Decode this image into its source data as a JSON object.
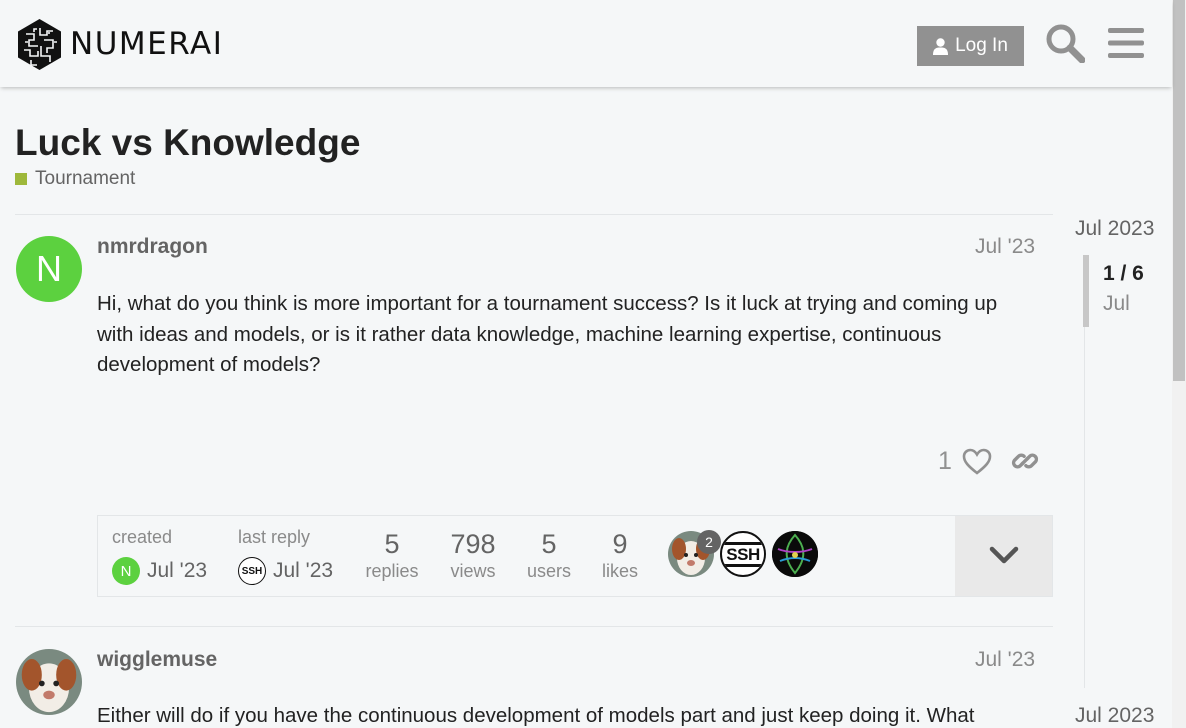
{
  "header": {
    "brand": "NUMERAI",
    "login_label": "Log In"
  },
  "topic": {
    "title": "Luck vs Knowledge",
    "category": "Tournament",
    "category_color": "#9eb83b"
  },
  "posts": [
    {
      "username": "nmrdragon",
      "avatar_letter": "N",
      "avatar_color": "#5cd13f",
      "date": "Jul '23",
      "body": "Hi, what do you think is more important for a tournament success? Is it luck at trying and coming up with ideas and models, or is it rather data knowledge, machine learning expertise, continuous development of models?",
      "likes": "1"
    },
    {
      "username": "wigglemuse",
      "date": "Jul '23",
      "body": "Either will do if you have the continuous development of models part and just keep doing it. What"
    }
  ],
  "summary": {
    "created_label": "created",
    "created_date": "Jul '23",
    "created_avatar": "N",
    "last_reply_label": "last reply",
    "last_reply_date": "Jul '23",
    "last_reply_avatar": "SSH",
    "stats": [
      {
        "value": "5",
        "label": "replies"
      },
      {
        "value": "798",
        "label": "views"
      },
      {
        "value": "5",
        "label": "users"
      },
      {
        "value": "9",
        "label": "likes"
      }
    ],
    "participant_badge": "2",
    "participant_ssh": "SSH"
  },
  "timeline": {
    "top_date": "Jul 2023",
    "position": "1 / 6",
    "position_date": "Jul",
    "bottom_date": "Jul 2023"
  },
  "icons": {
    "search": "search-icon",
    "menu": "hamburger-menu-icon",
    "like": "heart-icon",
    "share": "link-icon",
    "expand": "chevron-down-icon",
    "user": "user-icon"
  }
}
